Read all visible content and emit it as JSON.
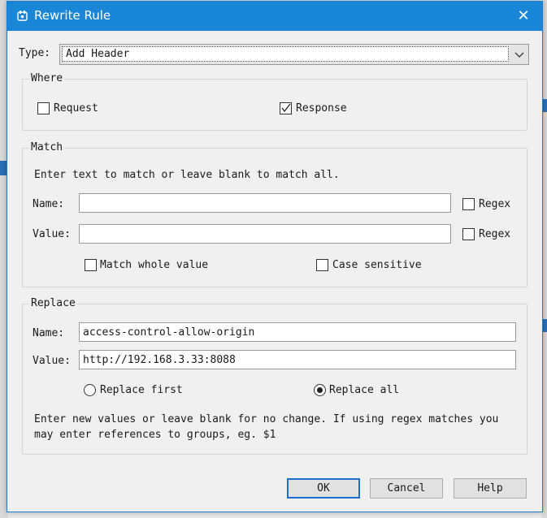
{
  "dialog": {
    "title": "Rewrite Rule",
    "close_glyph": "✕"
  },
  "type_row": {
    "label": "Type:",
    "value": "Add Header"
  },
  "where": {
    "title": "Where",
    "request": {
      "label": "Request",
      "checked": false
    },
    "response": {
      "label": "Response",
      "checked": true
    }
  },
  "match": {
    "title": "Match",
    "hint": "Enter text to match or leave blank to match all.",
    "name_label": "Name:",
    "name_value": "",
    "value_label": "Value:",
    "value_value": "",
    "regex_label": "Regex",
    "match_whole_label": "Match whole value",
    "case_sensitive_label": "Case sensitive"
  },
  "replace": {
    "title": "Replace",
    "name_label": "Name:",
    "name_value": "access-control-allow-origin",
    "value_label": "Value:",
    "value_value": "http://192.168.3.33:8088",
    "replace_first_label": "Replace first",
    "replace_all_label": "Replace all",
    "selected": "replace_all",
    "hint_line1": "Enter new values or leave blank for no change. If using regex matches you",
    "hint_line2": "may enter references to groups, eg. $1"
  },
  "buttons": {
    "ok": "OK",
    "cancel": "Cancel",
    "help": "Help"
  },
  "colors": {
    "titlebar": "#1a86d8",
    "accent": "#1a6fd0"
  }
}
